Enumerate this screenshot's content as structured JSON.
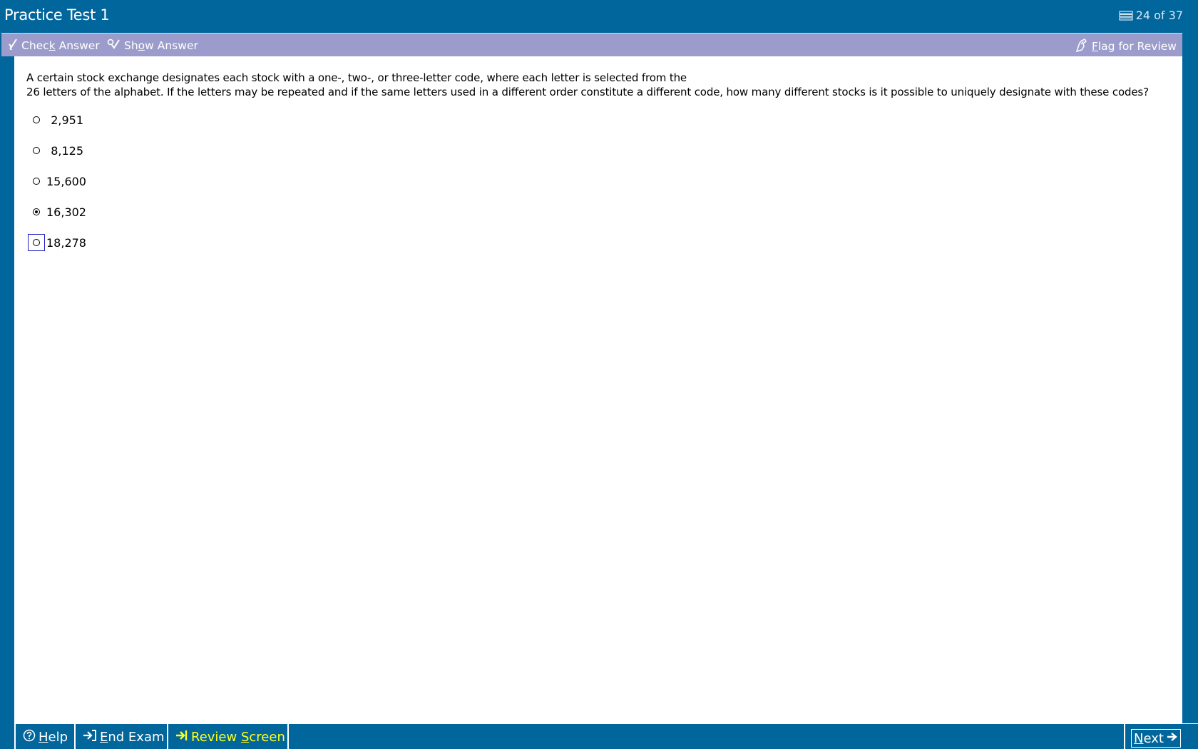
{
  "window": {
    "title": "Practice Test 1",
    "counter": "24 of 37"
  },
  "toolbar": {
    "check_answer": {
      "pre": "Chec",
      "key": "k",
      "post": " Answer"
    },
    "show_answer": {
      "pre": "Sh",
      "key": "o",
      "post": "w Answer"
    },
    "flag_review": {
      "pre": "",
      "key": "F",
      "post": "lag for Review"
    }
  },
  "question": {
    "line1": "A certain stock exchange designates each stock with a one-, two-, or three-letter code, where each letter is selected from the",
    "line2": "26 letters of the alphabet.  If the letters may be repeated and if the same letters used in a different order constitute a different code, how many different stocks is it possible to uniquely designate with these codes?"
  },
  "choices": [
    {
      "label": "2,951",
      "selected": false
    },
    {
      "label": "8,125",
      "selected": false
    },
    {
      "label": "15,600",
      "selected": false
    },
    {
      "label": "16,302",
      "selected": true
    },
    {
      "label": "18,278",
      "selected": false
    }
  ],
  "focused_choice_index": 4,
  "bottombar": {
    "help": {
      "pre": "",
      "key": "H",
      "post": "elp"
    },
    "end_exam": {
      "pre": "",
      "key": "E",
      "post": "nd Exam"
    },
    "review_screen": {
      "pre": "Review ",
      "key": "S",
      "post": "creen"
    },
    "next": {
      "pre": "",
      "key": "N",
      "post": "ext"
    }
  },
  "colors": {
    "frame": "#00669c",
    "toolbar": "#9c9ccc",
    "review_text": "#ffff22"
  }
}
